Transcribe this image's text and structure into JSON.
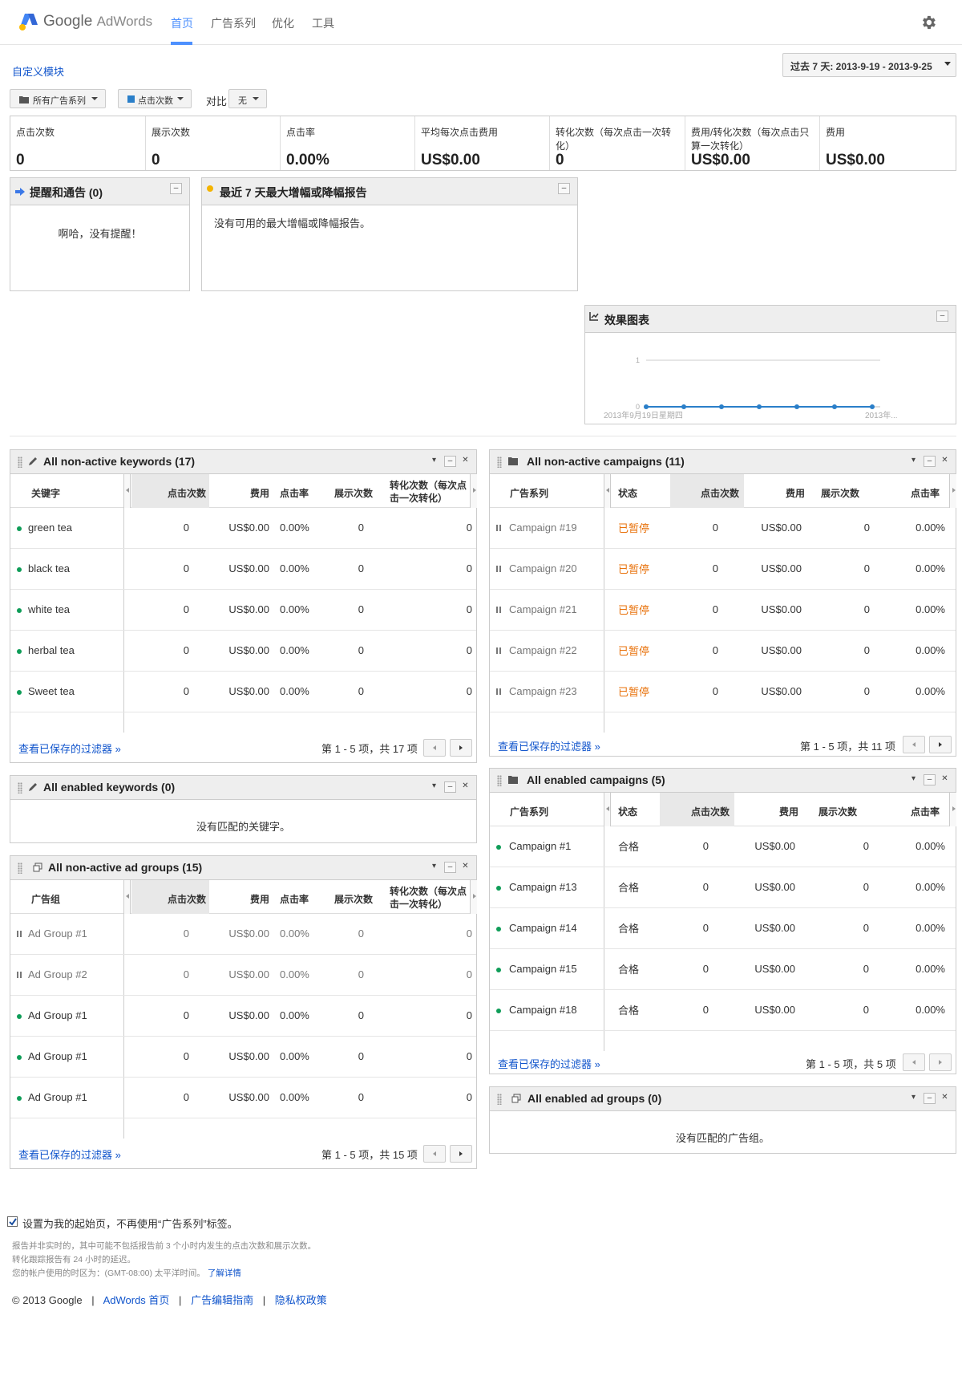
{
  "app": {
    "brand_google": "Google",
    "brand_product": "AdWords"
  },
  "nav": {
    "items": [
      "首页",
      "广告系列",
      "优化",
      "工具"
    ],
    "active_index": 0
  },
  "customize_label": "自定义模块",
  "date_range": "过去 7 天: 2013-9-19 - 2013-9-25",
  "filters": {
    "campaign_dd": "所有广告系列",
    "metric_dd": "点击次数",
    "compare_label": "对比",
    "compare_dd": "无"
  },
  "metrics": [
    {
      "label": "点击次数",
      "value": "0"
    },
    {
      "label": "展示次数",
      "value": "0"
    },
    {
      "label": "点击率",
      "value": "0.00%"
    },
    {
      "label": "平均每次点击费用",
      "value": "US$0.00"
    },
    {
      "label": "转化次数（每次点击一次转化）",
      "value": "0"
    },
    {
      "label": "费用/转化次数（每次点击只算一次转化）",
      "value": "US$0.00"
    },
    {
      "label": "费用",
      "value": "US$0.00"
    }
  ],
  "alerts": {
    "title": "提醒和通告 (0)",
    "message": "啊哈，没有提醒！"
  },
  "movers": {
    "title": "最近 7 天最大增幅或降幅报告",
    "message": "没有可用的最大增幅或降幅报告。"
  },
  "perf_chart": {
    "title": "效果图表",
    "x_start_label": "2013年9月19日星期四",
    "x_end_label": "2013年..."
  },
  "chart_data": {
    "type": "line",
    "title": "效果图表",
    "x": [
      "2013-9-19",
      "2013-9-20",
      "2013-9-21",
      "2013-9-22",
      "2013-9-23",
      "2013-9-24",
      "2013-9-25"
    ],
    "series": [
      {
        "values": [
          0,
          0,
          0,
          0,
          0,
          0,
          0
        ]
      }
    ],
    "ylim": [
      0,
      1
    ],
    "yticks": [
      "0",
      "1"
    ],
    "color": "#2a7fc9"
  },
  "common": {
    "saved_filters": "查看已保存的过滤器 »",
    "col_clicks": "点击次数",
    "col_cost": "费用",
    "col_ctr": "点击率",
    "col_impr": "展示次数",
    "col_conv": "转化次数（每次点击一次转化）",
    "col_status": "状态"
  },
  "kw_inactive": {
    "title": "All non-active keywords (17)",
    "col_name": "关键字",
    "rows": [
      {
        "name": "green tea",
        "clicks": "0",
        "cost": "US$0.00",
        "ctr": "0.00%",
        "impr": "0",
        "conv": "0"
      },
      {
        "name": "black tea",
        "clicks": "0",
        "cost": "US$0.00",
        "ctr": "0.00%",
        "impr": "0",
        "conv": "0"
      },
      {
        "name": "white tea",
        "clicks": "0",
        "cost": "US$0.00",
        "ctr": "0.00%",
        "impr": "0",
        "conv": "0"
      },
      {
        "name": "herbal tea",
        "clicks": "0",
        "cost": "US$0.00",
        "ctr": "0.00%",
        "impr": "0",
        "conv": "0"
      },
      {
        "name": "Sweet tea",
        "clicks": "0",
        "cost": "US$0.00",
        "ctr": "0.00%",
        "impr": "0",
        "conv": "0"
      }
    ],
    "pagination": "第 1 - 5 项，共 17 项"
  },
  "kw_enabled": {
    "title": "All enabled keywords (0)",
    "message": "没有匹配的关键字。"
  },
  "ag_inactive": {
    "title": "All non-active ad groups (15)",
    "col_name": "广告组",
    "rows": [
      {
        "name": "Ad Group #1",
        "state": "paused",
        "clicks": "0",
        "cost": "US$0.00",
        "ctr": "0.00%",
        "impr": "0",
        "conv": "0"
      },
      {
        "name": "Ad Group #2",
        "state": "paused",
        "clicks": "0",
        "cost": "US$0.00",
        "ctr": "0.00%",
        "impr": "0",
        "conv": "0"
      },
      {
        "name": "Ad Group #1",
        "state": "active",
        "clicks": "0",
        "cost": "US$0.00",
        "ctr": "0.00%",
        "impr": "0",
        "conv": "0"
      },
      {
        "name": "Ad Group #1",
        "state": "active",
        "clicks": "0",
        "cost": "US$0.00",
        "ctr": "0.00%",
        "impr": "0",
        "conv": "0"
      },
      {
        "name": "Ad Group #1",
        "state": "active",
        "clicks": "0",
        "cost": "US$0.00",
        "ctr": "0.00%",
        "impr": "0",
        "conv": "0"
      }
    ],
    "pagination": "第 1 - 5 项，共 15 项"
  },
  "camp_inactive": {
    "title": "All non-active campaigns (11)",
    "col_name": "广告系列",
    "rows": [
      {
        "name": "Campaign #19",
        "status": "已暂停",
        "clicks": "0",
        "cost": "US$0.00",
        "impr": "0",
        "ctr": "0.00%"
      },
      {
        "name": "Campaign #20",
        "status": "已暂停",
        "clicks": "0",
        "cost": "US$0.00",
        "impr": "0",
        "ctr": "0.00%"
      },
      {
        "name": "Campaign #21",
        "status": "已暂停",
        "clicks": "0",
        "cost": "US$0.00",
        "impr": "0",
        "ctr": "0.00%"
      },
      {
        "name": "Campaign #22",
        "status": "已暂停",
        "clicks": "0",
        "cost": "US$0.00",
        "impr": "0",
        "ctr": "0.00%"
      },
      {
        "name": "Campaign #23",
        "status": "已暂停",
        "clicks": "0",
        "cost": "US$0.00",
        "impr": "0",
        "ctr": "0.00%"
      }
    ],
    "pagination": "第 1 - 5 项，共 11 项"
  },
  "camp_enabled": {
    "title": "All enabled campaigns (5)",
    "col_name": "广告系列",
    "rows": [
      {
        "name": "Campaign #1",
        "status": "合格",
        "clicks": "0",
        "cost": "US$0.00",
        "impr": "0",
        "ctr": "0.00%"
      },
      {
        "name": "Campaign #13",
        "status": "合格",
        "clicks": "0",
        "cost": "US$0.00",
        "impr": "0",
        "ctr": "0.00%"
      },
      {
        "name": "Campaign #14",
        "status": "合格",
        "clicks": "0",
        "cost": "US$0.00",
        "impr": "0",
        "ctr": "0.00%"
      },
      {
        "name": "Campaign #15",
        "status": "合格",
        "clicks": "0",
        "cost": "US$0.00",
        "impr": "0",
        "ctr": "0.00%"
      },
      {
        "name": "Campaign #18",
        "status": "合格",
        "clicks": "0",
        "cost": "US$0.00",
        "impr": "0",
        "ctr": "0.00%"
      }
    ],
    "pagination": "第 1 - 5 项，共 5 项"
  },
  "ag_enabled": {
    "title": "All enabled ad groups (0)",
    "message": "没有匹配的广告组。"
  },
  "footer": {
    "start_page": "设置为我的起始页，不再使用“广告系列”标签。",
    "note1": "报告并非实时的，其中可能不包括报告前 3 个小时内发生的点击次数和展示次数。",
    "note2": "转化跟踪报告有 24 小时的延迟。",
    "note3": "您的帐户使用的时区为：(GMT-08:00) 太平洋时间。",
    "learn_more": "了解详情",
    "copyright": "© 2013 Google",
    "link_home": "AdWords 首页",
    "link_editorial": "广告编辑指南",
    "link_privacy": "隐私权政策"
  },
  "colors": {
    "brand_blue": "#4d90fe",
    "link": "#1155cc",
    "status_paused": "#e8710a",
    "status_ok_dot": "#0f9d58"
  }
}
